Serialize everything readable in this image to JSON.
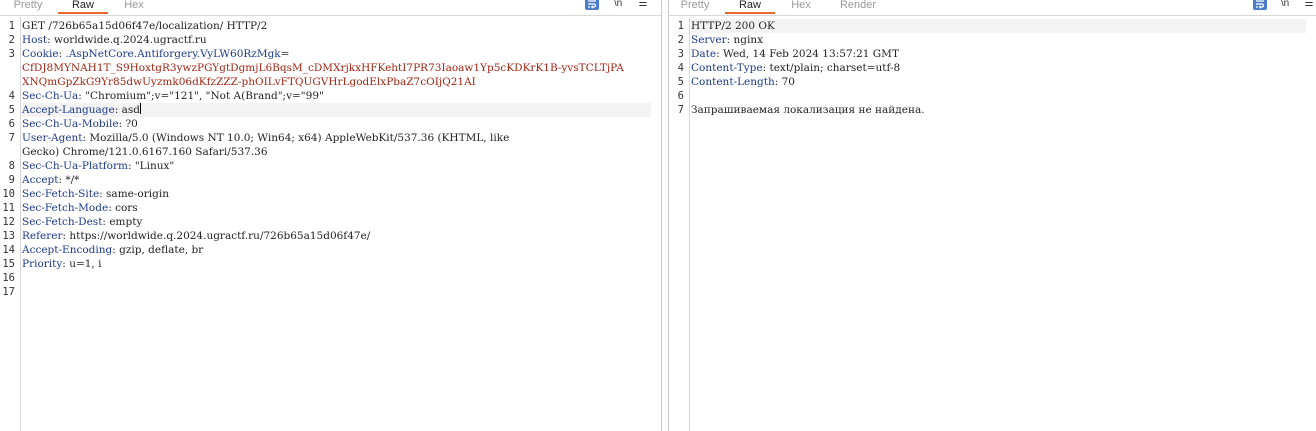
{
  "request": {
    "tabs": [
      "Pretty",
      "Raw",
      "Hex"
    ],
    "active_tab": "Raw",
    "tools": {
      "newline": "\\n",
      "menu": "☰",
      "wrap": "wrap-lines"
    },
    "line_numbers": [
      "1",
      "2",
      "3",
      "4",
      "5",
      "6",
      "7",
      "8",
      "9",
      "10",
      "11",
      "12",
      "13",
      "14",
      "15",
      "16",
      "17"
    ],
    "request_line": "GET /726b65a15d06f47e/localization/ HTTP/2",
    "host": {
      "name": "Host",
      "value": "worldwide.q.2024.ugractf.ru"
    },
    "cookie": {
      "name": "Cookie",
      "key": ".AspNetCore.Antiforgery.VyLW60RzMgk",
      "wrapped_lines": [
        "CfDJ8MYNAH1T_S9HoxtgR3ywzPGYgtDgmjL6BqsM_cDMXrjkxHFKehtI7PR73Iaoaw1Yp5cKDKrK1B-yvsTCLTjPA",
        "XNQmGpZkG9Yr85dwUyzmk06dKfzZZZ-phOILvFTQUGVHrLgodElxPbaZ7cOIjQ21AI"
      ]
    },
    "sec_ch_ua": {
      "name": "Sec-Ch-Ua",
      "value": "\"Chromium\";v=\"121\", \"Not A(Brand\";v=\"99\""
    },
    "accept_language": {
      "name": "Accept-Language",
      "value": "asd"
    },
    "sec_ch_ua_mobile": {
      "name": "Sec-Ch-Ua-Mobile",
      "value": "?0"
    },
    "user_agent": {
      "name": "User-Agent",
      "value_line1": "Mozilla/5.0 (Windows NT 10.0; Win64; x64) AppleWebKit/537.36 (KHTML, like",
      "value_line2": "Gecko) Chrome/121.0.6167.160 Safari/537.36"
    },
    "sec_ch_ua_platform": {
      "name": "Sec-Ch-Ua-Platform",
      "value": "\"Linux\""
    },
    "accept": {
      "name": "Accept",
      "value": "*/*"
    },
    "sec_fetch_site": {
      "name": "Sec-Fetch-Site",
      "value": "same-origin"
    },
    "sec_fetch_mode": {
      "name": "Sec-Fetch-Mode",
      "value": "cors"
    },
    "sec_fetch_dest": {
      "name": "Sec-Fetch-Dest",
      "value": "empty"
    },
    "referer": {
      "name": "Referer",
      "value": "https://worldwide.q.2024.ugractf.ru/726b65a15d06f47e/"
    },
    "accept_encoding": {
      "name": "Accept-Encoding",
      "value": "gzip, deflate, br"
    },
    "priority": {
      "name": "Priority",
      "value": "u=1, i"
    }
  },
  "response": {
    "tabs": [
      "Pretty",
      "Raw",
      "Hex",
      "Render"
    ],
    "active_tab": "Raw",
    "tools": {
      "newline": "\\n",
      "menu": "☰",
      "wrap": "wrap-lines"
    },
    "line_numbers": [
      "1",
      "2",
      "3",
      "4",
      "5",
      "6",
      "7"
    ],
    "status_line": "HTTP/2 200 OK",
    "server": {
      "name": "Server",
      "value": "nginx"
    },
    "date": {
      "name": "Date",
      "value": "Wed, 14 Feb 2024 13:57:21 GMT"
    },
    "content_type": {
      "name": "Content-Type",
      "value": "text/plain; charset=utf-8"
    },
    "content_length": {
      "name": "Content-Length",
      "value": "70"
    },
    "body": "Запрашиваемая локализация не найдена."
  },
  "colors": {
    "accent": "#e8692d",
    "header_name": "#1d3a8a",
    "cookie_value": "#a42413",
    "wrap_button": "#4a7cc7"
  }
}
